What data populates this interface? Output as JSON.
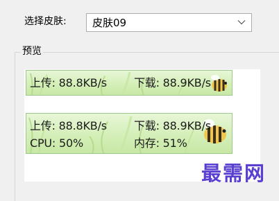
{
  "skin_selector": {
    "label": "选择皮肤:",
    "selected": "皮肤09"
  },
  "preview": {
    "title": "预览",
    "skin_one_line": {
      "upload": "上传: 88.8KB/s",
      "download": "下载: 88.9KB/s"
    },
    "skin_two_line": {
      "upload": "上传: 88.8KB/s",
      "download": "下载: 88.9KB/s",
      "cpu": "CPU: 50%",
      "memory": "内存: 51%"
    }
  },
  "watermark": "最需网",
  "colors": {
    "skin_bg": "#d4efb8",
    "watermark": "#5a3fd0"
  }
}
